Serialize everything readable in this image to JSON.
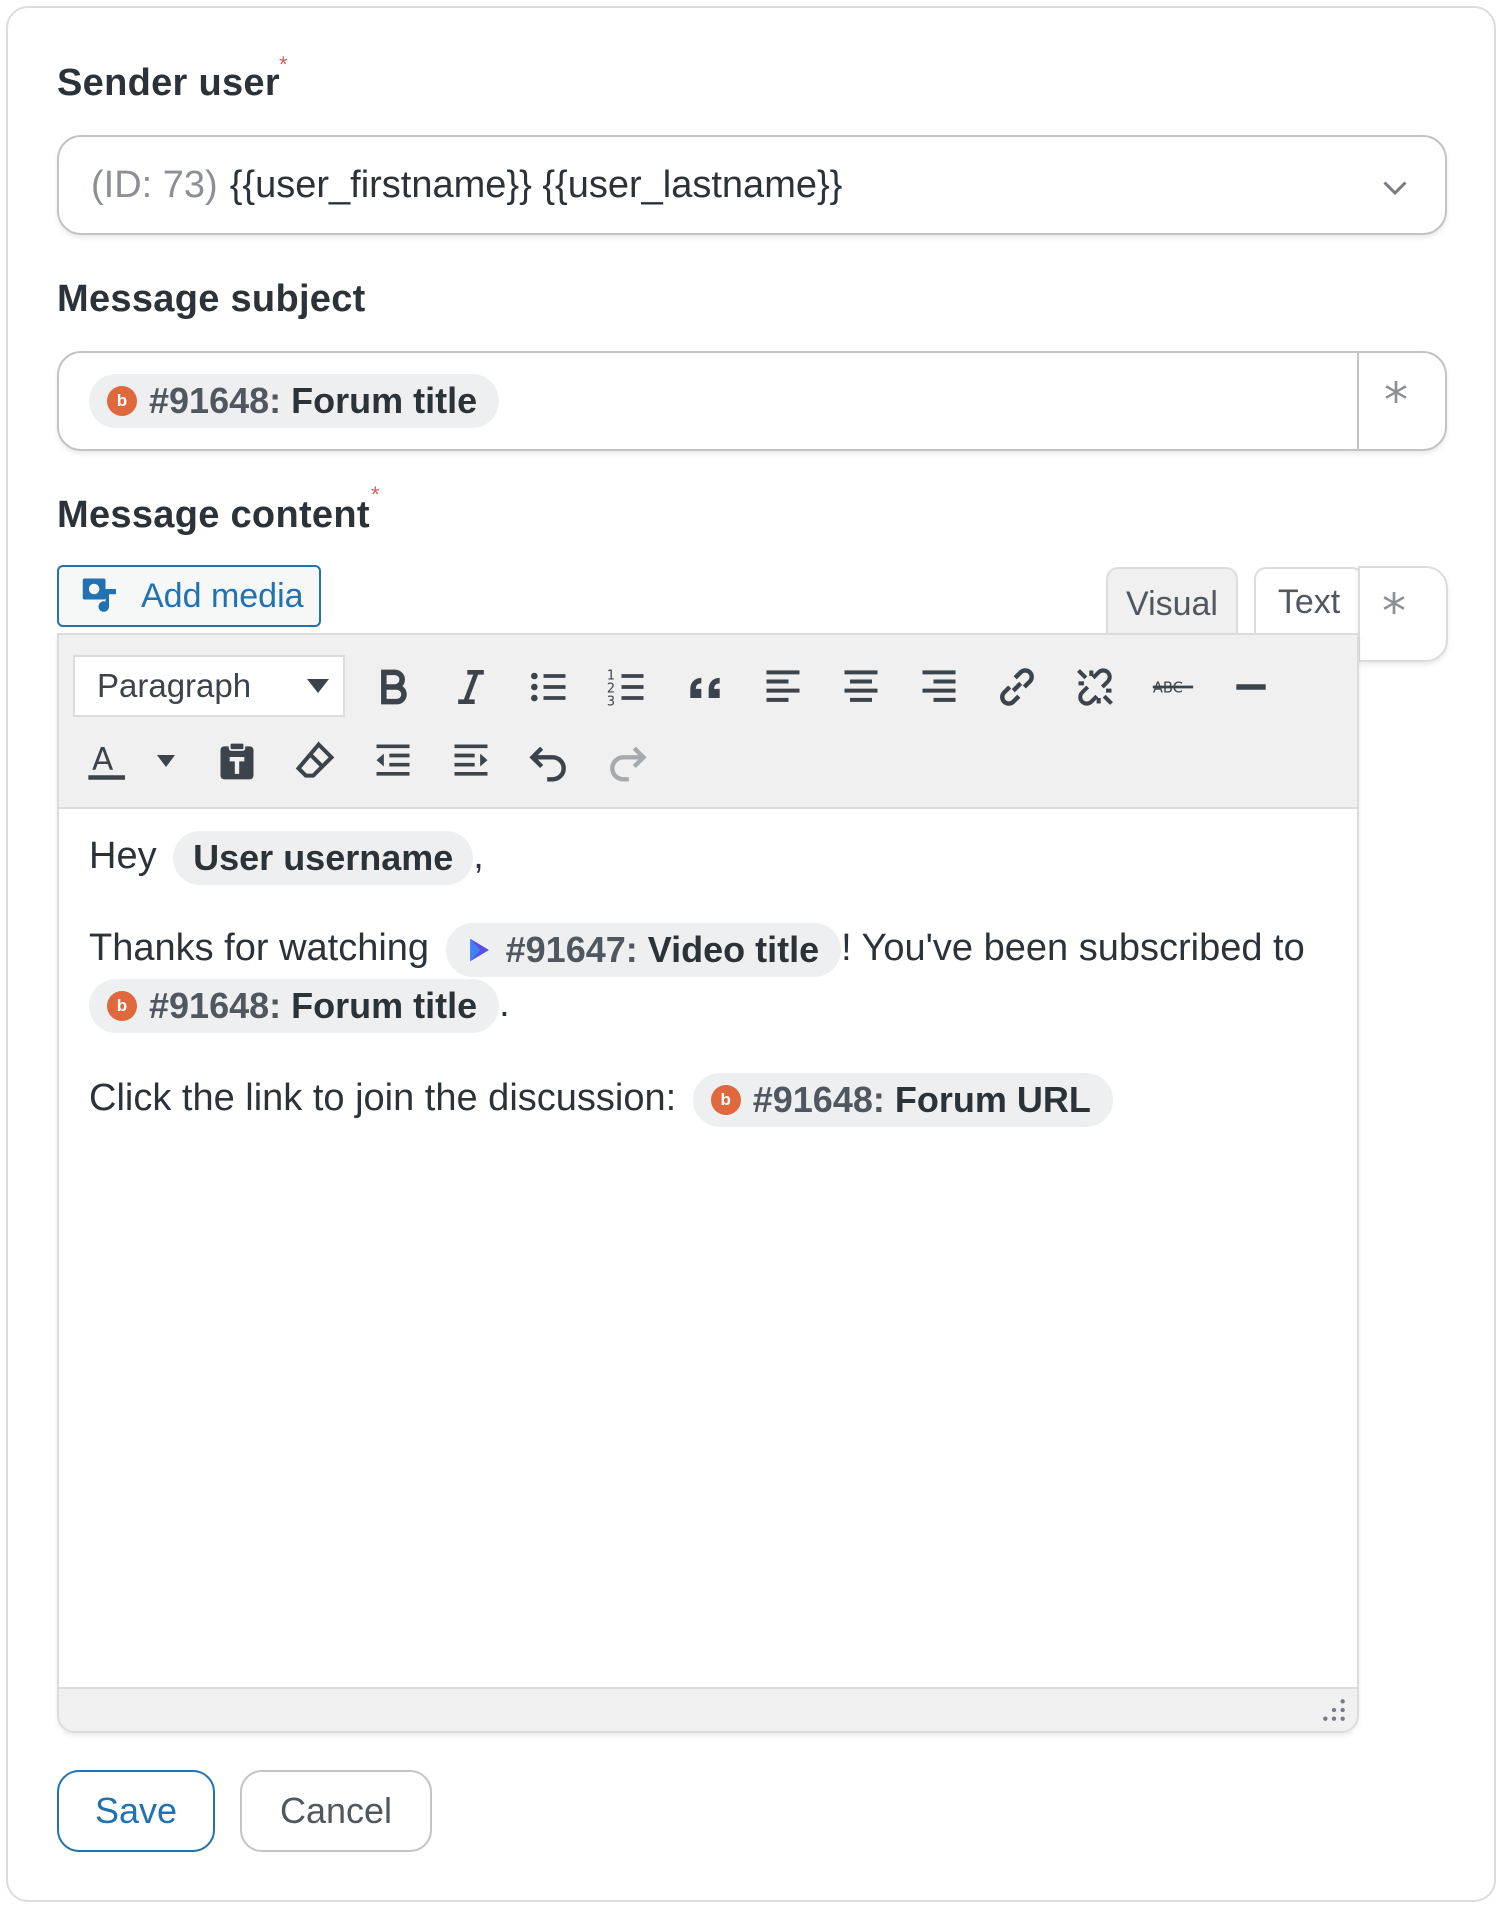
{
  "sender": {
    "label": "Sender user",
    "required_mark": "*",
    "prefix": "(ID: 73)",
    "value": "{{user_firstname}} {{user_lastname}}"
  },
  "subject": {
    "label": "Message subject",
    "pill_id": "#91648:",
    "pill_title": "Forum title",
    "ai_mark": "*"
  },
  "content": {
    "label": "Message content",
    "required_mark": "*",
    "add_media_label": "Add media",
    "tabs": {
      "visual": "Visual",
      "text": "Text"
    },
    "ai_mark": "*",
    "format_select": "Paragraph",
    "toolbar_row1": [
      "bold-icon",
      "italic-icon",
      "bullet-list-icon",
      "numbered-list-icon",
      "blockquote-icon",
      "align-left-icon",
      "align-center-icon",
      "align-right-icon",
      "link-icon",
      "unlink-icon",
      "strikethrough-icon",
      "horizontal-rule-icon"
    ],
    "toolbar_row2": [
      "text-color-icon",
      "paste-as-text-icon",
      "clear-formatting-icon",
      "outdent-icon",
      "indent-icon",
      "undo-icon",
      "redo-icon"
    ],
    "body": {
      "line1_before": "Hey",
      "line1_pill": "User username",
      "line1_after": ",",
      "line2_before": "Thanks for watching",
      "line2_pill_id": "#91647:",
      "line2_pill_title": "Video title",
      "line2_after": "! You've been subscribed to",
      "line3_pill_id": "#91648:",
      "line3_pill_title": "Forum title",
      "line3_after": ".",
      "line4_before": "Click the link to join the discussion:",
      "line4_pill_id": "#91648:",
      "line4_pill_title": "Forum URL"
    }
  },
  "actions": {
    "save": "Save",
    "cancel": "Cancel"
  },
  "colors": {
    "accent": "#2271b1",
    "required": "#e05a5a",
    "forum_icon": "#e0683d",
    "video_icon": "#5b4fe0"
  }
}
